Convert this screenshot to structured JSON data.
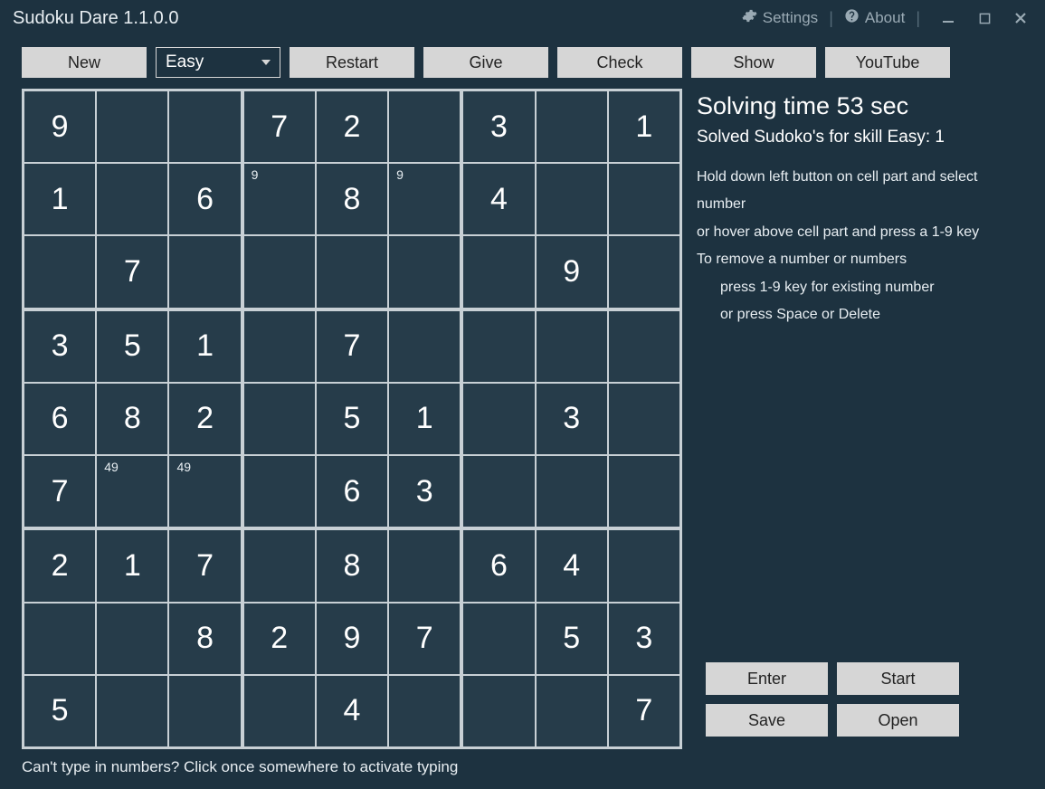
{
  "app": {
    "title": "Sudoku Dare 1.1.0.0",
    "settings_label": "Settings",
    "about_label": "About"
  },
  "toolbar": {
    "new_label": "New",
    "difficulty_selected": "Easy",
    "restart_label": "Restart",
    "give_label": "Give",
    "check_label": "Check",
    "show_label": "Show",
    "youtube_label": "YouTube"
  },
  "side": {
    "solving_time": "Solving time 53 sec",
    "solved_count": "Solved Sudoko's for skill Easy: 1",
    "help1": "Hold down left button on cell part and select number",
    "help2": "or hover above cell part and press a 1-9 key",
    "help3": "To remove a number or numbers",
    "help4": "press 1-9 key for existing number",
    "help5": "or press Space or Delete",
    "enter_label": "Enter",
    "start_label": "Start",
    "save_label": "Save",
    "open_label": "Open"
  },
  "footer": {
    "hint": "Can't type in numbers? Click once somewhere to activate typing"
  },
  "grid": {
    "values": [
      [
        "9",
        "",
        "",
        "7",
        "2",
        "",
        "3",
        "",
        "1"
      ],
      [
        "1",
        "",
        "6",
        "",
        "8",
        "",
        "4",
        "",
        ""
      ],
      [
        "",
        "7",
        "",
        "",
        "",
        "",
        "",
        "9",
        ""
      ],
      [
        "3",
        "5",
        "1",
        "",
        "7",
        "",
        "",
        "",
        ""
      ],
      [
        "6",
        "8",
        "2",
        "",
        "5",
        "1",
        "",
        "3",
        ""
      ],
      [
        "7",
        "",
        "",
        "",
        "6",
        "3",
        "",
        "",
        ""
      ],
      [
        "2",
        "1",
        "7",
        "",
        "8",
        "",
        "6",
        "4",
        ""
      ],
      [
        "",
        "",
        "8",
        "2",
        "9",
        "7",
        "",
        "5",
        "3"
      ],
      [
        "5",
        "",
        "",
        "",
        "4",
        "",
        "",
        "",
        "7"
      ]
    ],
    "notes": [
      [
        "",
        "",
        "",
        "",
        "",
        "",
        "",
        "",
        ""
      ],
      [
        "",
        "",
        "",
        "9",
        "",
        "9",
        "",
        "",
        ""
      ],
      [
        "",
        "",
        "",
        "",
        "",
        "",
        "",
        "",
        ""
      ],
      [
        "",
        "",
        "",
        "",
        "",
        "",
        "",
        "",
        ""
      ],
      [
        "",
        "",
        "",
        "",
        "",
        "",
        "",
        "",
        ""
      ],
      [
        "",
        "49",
        "49",
        "",
        "",
        "",
        "",
        "",
        ""
      ],
      [
        "",
        "",
        "",
        "",
        "",
        "",
        "",
        "",
        ""
      ],
      [
        "",
        "",
        "",
        "",
        "",
        "",
        "",
        "",
        ""
      ],
      [
        "",
        "",
        "",
        "",
        "",
        "",
        "",
        "",
        ""
      ]
    ]
  }
}
